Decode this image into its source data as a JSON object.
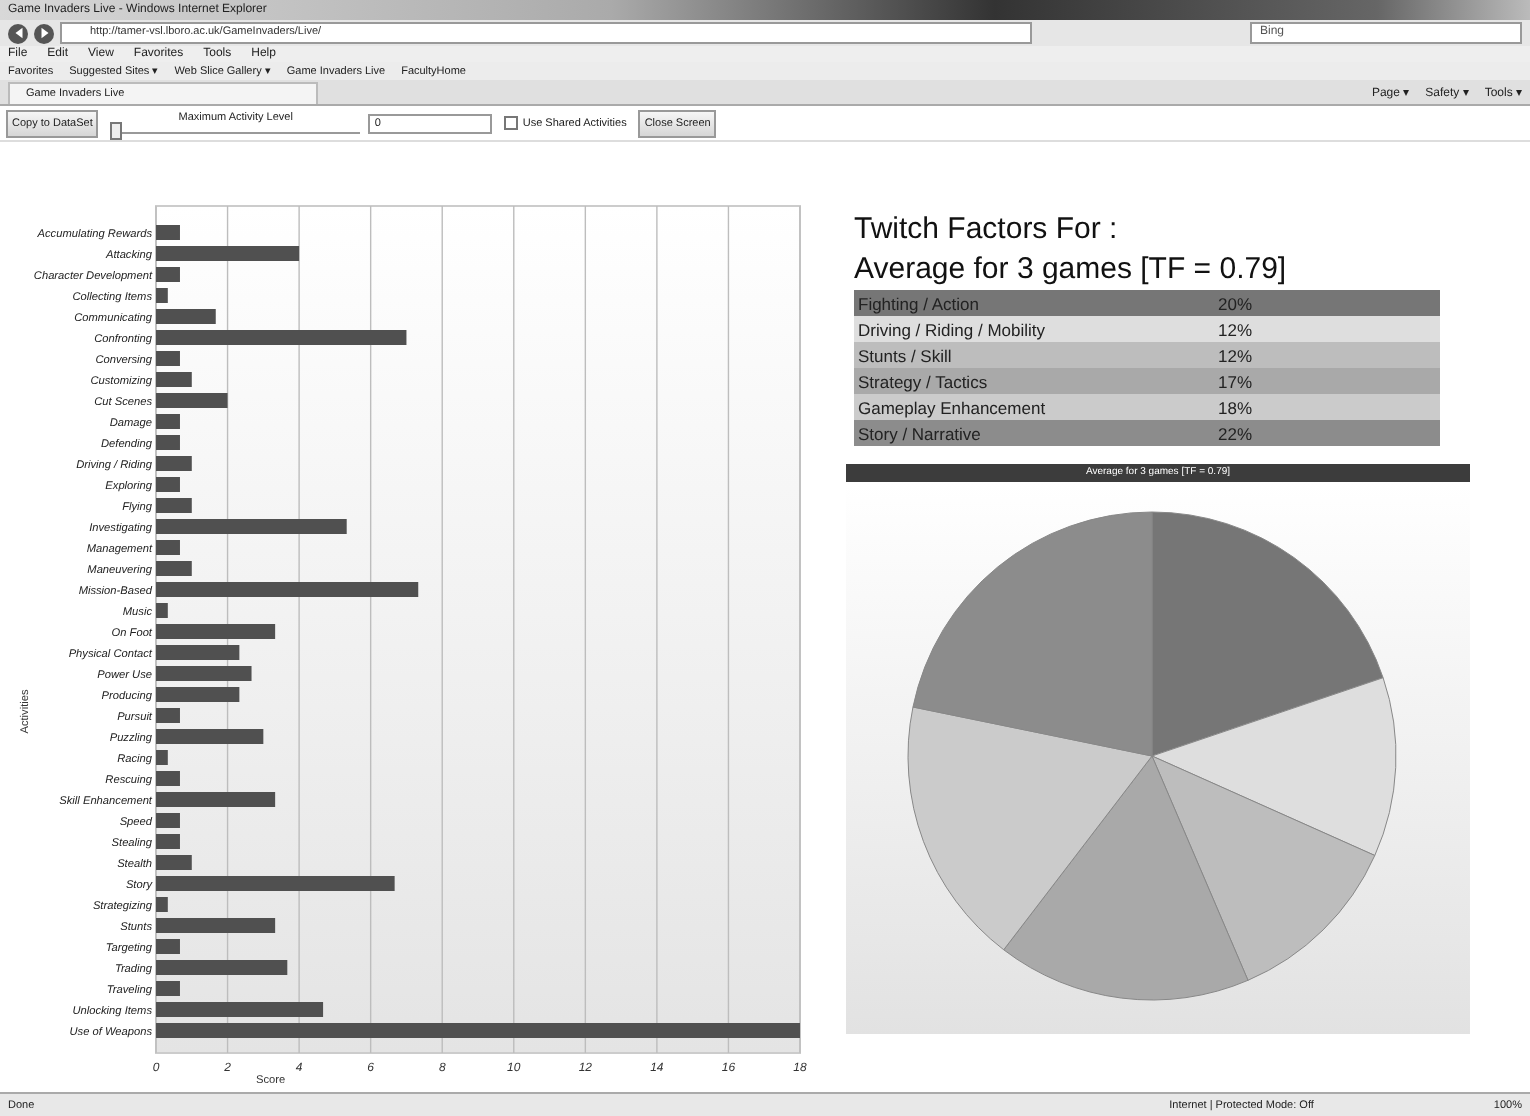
{
  "browser": {
    "title": "Game Invaders Live - Windows Internet Explorer",
    "address": "http://tamer-vsl.lboro.ac.uk/GameInvaders/Live/",
    "search_placeholder": "Bing",
    "menu": [
      "File",
      "Edit",
      "View",
      "Favorites",
      "Tools",
      "Help"
    ],
    "favorites": [
      "Favorites",
      "Suggested Sites ▾",
      "Web Slice Gallery ▾",
      "Game Invaders Live",
      "FacultyHome"
    ],
    "tab": "Game Invaders Live",
    "commands": [
      "Page ▾",
      "Safety ▾",
      "Tools ▾"
    ]
  },
  "toolbar": {
    "copy_button": "Copy to DataSet",
    "slider_label": "Maximum Activity Level",
    "slider": {
      "level": 0
    },
    "value": "0",
    "shared": {
      "label": "Use Shared Activities",
      "checked": false
    },
    "close_button": "Close Screen"
  },
  "activity_chart": {
    "chart_data": {
      "type": "bar",
      "orientation": "horizontal",
      "xlabel": "Score",
      "ylabel": "Activities",
      "grid": true,
      "xlim": [
        0,
        18
      ],
      "xticks": [
        0,
        2,
        4,
        6,
        8,
        10,
        12,
        14,
        16,
        18
      ],
      "categories": [
        "Accumulating Rewards",
        "Attacking",
        "Character Development",
        "Collecting Items",
        "Communicating",
        "Confronting",
        "Conversing",
        "Customizing",
        "Cut Scenes",
        "Damage",
        "Defending",
        "Driving / Riding",
        "Exploring",
        "Flying",
        "Investigating",
        "Management",
        "Maneuvering",
        "Mission-Based",
        "Music",
        "On Foot",
        "Physical Contact",
        "Power Use",
        "Producing",
        "Pursuit",
        "Puzzling",
        "Racing",
        "Rescuing",
        "Skill Enhancement",
        "Speed",
        "Stealing",
        "Stealth",
        "Story",
        "Strategizing",
        "Stunts",
        "Targeting",
        "Trading",
        "Traveling",
        "Unlocking Items",
        "Use of Weapons"
      ],
      "series": [
        {
          "color": "#505050",
          "values": [
            0.67,
            4,
            0.67,
            0.33,
            1.67,
            7,
            0.67,
            1,
            2,
            0.67,
            0.67,
            1,
            0.67,
            1,
            5.33,
            0.67,
            1,
            7.33,
            0.33,
            3.33,
            2.33,
            2.67,
            2.33,
            0.67,
            3,
            0.33,
            0.67,
            3.33,
            0.67,
            0.67,
            1,
            6.67,
            0.33,
            3.33,
            0.67,
            3.67,
            0.67,
            4.67,
            18
          ]
        }
      ]
    }
  },
  "twitch": {
    "heading": "Twitch Factors For :",
    "subheading": "Average for 3 games [TF = 0.79]",
    "rows": [
      {
        "percent": "20%",
        "color": "#767676"
      },
      {
        "percent": "12%",
        "color": "#dedede"
      },
      {
        "percent": "12%",
        "color": "#bdbdbd"
      },
      {
        "percent": "17%",
        "color": "#a9a9a9"
      },
      {
        "percent": "18%",
        "color": "#cbcbcb"
      },
      {
        "percent": "22%",
        "color": "#8c8c8c"
      }
    ]
  },
  "pie": {
    "chart_data": {
      "type": "pie",
      "title": "Average for 3 games [TF = 0.79]",
      "categories": [
        "Fighting / Action",
        "Driving / Riding / Mobility",
        "Stunts / Skill",
        "Strategy / Tactics",
        "Gameplay Enhancement",
        "Story / Narrative"
      ],
      "values": [
        20,
        12,
        12,
        17,
        18,
        22
      ]
    }
  },
  "status_bar": {
    "left": "Done",
    "zone": "Internet | Protected Mode: Off",
    "zoom": "100%"
  }
}
